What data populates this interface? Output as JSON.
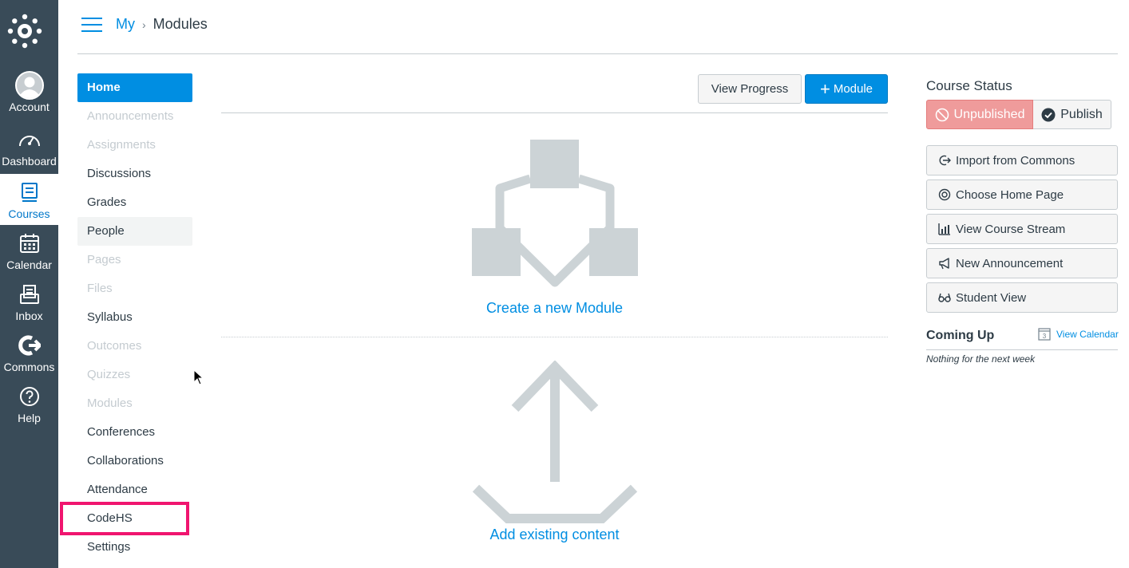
{
  "global_nav": {
    "items": [
      {
        "label": "Account",
        "icon": "user-avatar-icon"
      },
      {
        "label": "Dashboard",
        "icon": "dashboard-speedometer-icon"
      },
      {
        "label": "Courses",
        "icon": "book-icon",
        "active": true
      },
      {
        "label": "Calendar",
        "icon": "calendar-icon"
      },
      {
        "label": "Inbox",
        "icon": "inbox-icon"
      },
      {
        "label": "Commons",
        "icon": "commons-icon"
      },
      {
        "label": "Help",
        "icon": "help-icon"
      }
    ]
  },
  "breadcrumb": {
    "course": "My",
    "current": "Modules"
  },
  "course_nav": {
    "items": [
      {
        "label": "Home",
        "state": "active"
      },
      {
        "label": "Announcements",
        "state": "disabled"
      },
      {
        "label": "Assignments",
        "state": "disabled"
      },
      {
        "label": "Discussions",
        "state": "enabled"
      },
      {
        "label": "Grades",
        "state": "enabled"
      },
      {
        "label": "People",
        "state": "hover"
      },
      {
        "label": "Pages",
        "state": "disabled"
      },
      {
        "label": "Files",
        "state": "disabled"
      },
      {
        "label": "Syllabus",
        "state": "enabled"
      },
      {
        "label": "Outcomes",
        "state": "disabled"
      },
      {
        "label": "Quizzes",
        "state": "disabled"
      },
      {
        "label": "Modules",
        "state": "disabled"
      },
      {
        "label": "Conferences",
        "state": "enabled"
      },
      {
        "label": "Collaborations",
        "state": "enabled"
      },
      {
        "label": "Attendance",
        "state": "enabled"
      },
      {
        "label": "CodeHS",
        "state": "enabled",
        "highlighted": true
      },
      {
        "label": "Settings",
        "state": "enabled"
      }
    ]
  },
  "toolbar": {
    "view_progress": "View Progress",
    "add_module": "Module"
  },
  "empty_state": {
    "create_link": "Create a new Module",
    "add_link": "Add existing content"
  },
  "sidebar": {
    "course_status_title": "Course Status",
    "unpublished_label": "Unpublished",
    "publish_label": "Publish",
    "buttons": [
      {
        "label": "Import from Commons",
        "icon": "commons-import-icon"
      },
      {
        "label": "Choose Home Page",
        "icon": "target-icon"
      },
      {
        "label": "View Course Stream",
        "icon": "stream-chart-icon"
      },
      {
        "label": "New Announcement",
        "icon": "megaphone-icon"
      },
      {
        "label": "Student View",
        "icon": "glasses-icon"
      }
    ],
    "coming_up_title": "Coming Up",
    "view_calendar": "View Calendar",
    "calendar_day": "3",
    "nothing_text": "Nothing for the next week"
  },
  "colors": {
    "brand_blue": "#008ee2",
    "nav_bg": "#394b58",
    "highlight": "#f0156f",
    "unpublished": "#ef9b9b"
  }
}
